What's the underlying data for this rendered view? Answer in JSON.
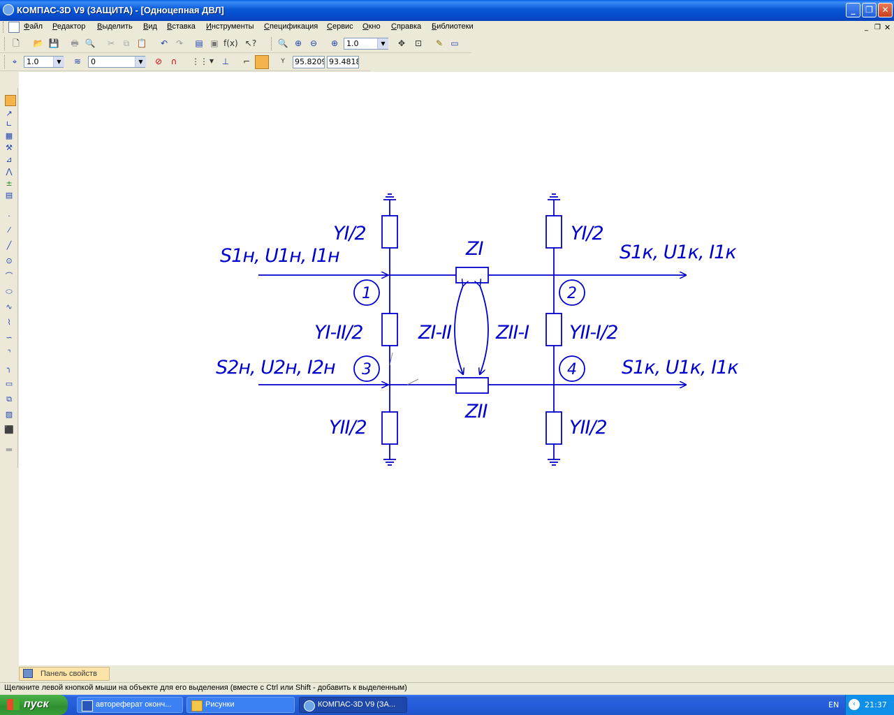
{
  "window": {
    "title": "КОМПАС-3D V9 (ЗАЩИТА) - [Одноцепная ДВЛ]",
    "minimize": "_",
    "restore": "❐",
    "close": "✕"
  },
  "menu": [
    "Файл",
    "Редактор",
    "Выделить",
    "Вид",
    "Вставка",
    "Инструменты",
    "Спецификация",
    "Сервис",
    "Окно",
    "Справка",
    "Библиотеки"
  ],
  "toolbar1": {
    "zoom": "1.0"
  },
  "toolbar2": {
    "step": "1.0",
    "layer": "0",
    "coord_x": "95.8209",
    "coord_y": "93.4818"
  },
  "drawing": {
    "labels": {
      "y1_top_left": "YI/2",
      "y1_top_right": "YI/2",
      "zi": "ZI",
      "s1n": "S1н, U1н, I1н",
      "s1k_top": "S1к, U1к, I1к",
      "node1": "1",
      "node2": "2",
      "node3": "3",
      "node4": "4",
      "y12_left": "YI-II/2",
      "y21_right": "YII-I/2",
      "z12": "ZI-II",
      "z21": "ZII-I",
      "s2n": "S2н, U2н, I2н",
      "s1k_bottom": "S1к, U1к, I1к",
      "zii": "ZII",
      "yii_left": "YII/2",
      "yii_right": "YII/2"
    },
    "line_color": "#0000CC"
  },
  "panel": {
    "tab_label": "Панель свойств"
  },
  "status": {
    "text": "Щелкните левой кнопкой мыши на объекте для его выделения (вместе с Ctrl или Shift - добавить к выделенным)"
  },
  "taskbar": {
    "start": "пуск",
    "tasks": [
      "автореферат оконч...",
      "Рисунки",
      "КОМПАС-3D V9 (ЗА..."
    ],
    "lang": "EN",
    "time": "21:37"
  }
}
